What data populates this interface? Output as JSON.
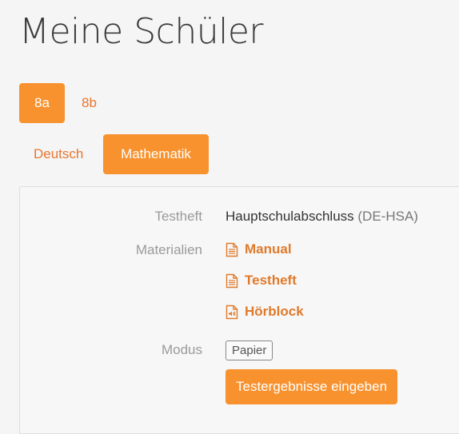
{
  "page": {
    "title": "Meine Schüler"
  },
  "classes": [
    {
      "label": "8a",
      "active": true
    },
    {
      "label": "8b",
      "active": false
    }
  ],
  "subjects": [
    {
      "label": "Deutsch",
      "active": false
    },
    {
      "label": "Mathematik",
      "active": true
    }
  ],
  "details": {
    "testheft_label": "Testheft",
    "testheft_value": "Hauptschulabschluss",
    "testheft_code": "(DE-HSA)",
    "materialien_label": "Materialien",
    "materials": [
      {
        "label": "Manual",
        "icon": "document-icon"
      },
      {
        "label": "Testheft",
        "icon": "document-icon"
      },
      {
        "label": "Hörblock",
        "icon": "audio-file-icon"
      }
    ],
    "modus_label": "Modus",
    "modus_value": "Papier",
    "action_label": "Testergebnisse eingeben"
  },
  "colors": {
    "accent": "#f7922e",
    "link": "#e07a2c"
  }
}
